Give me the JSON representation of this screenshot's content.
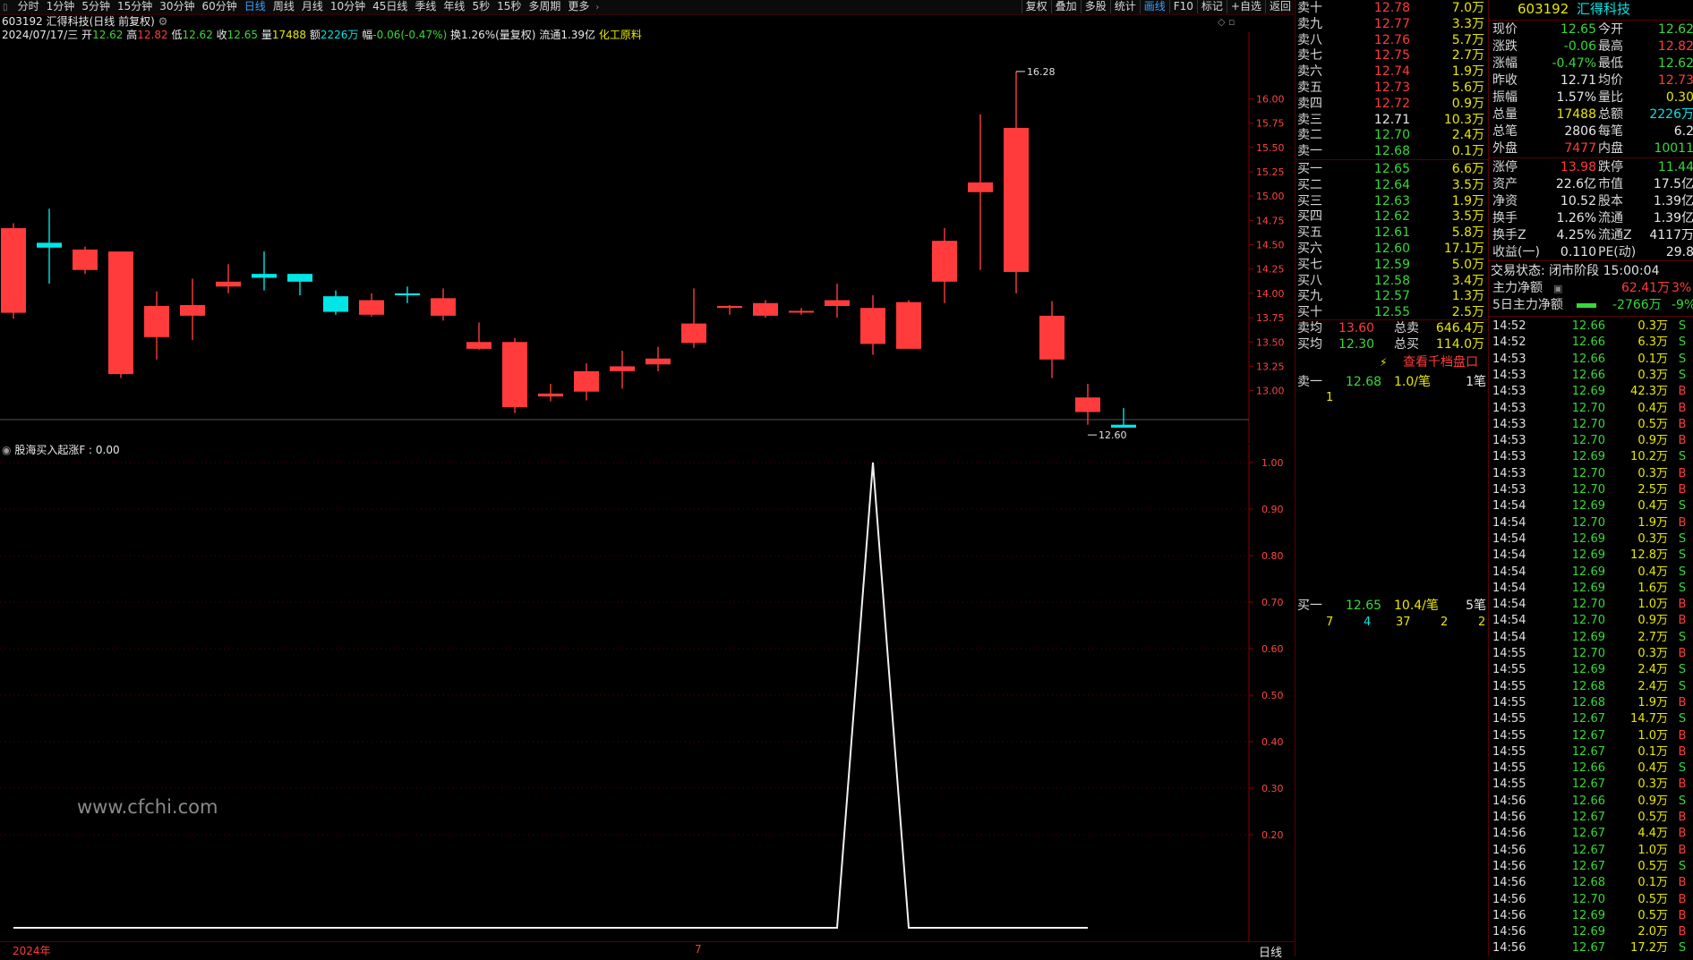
{
  "toolbar": {
    "left_items": [
      "分时",
      "1分钟",
      "5分钟",
      "15分钟",
      "30分钟",
      "60分钟",
      "日线",
      "周线",
      "月线",
      "10分钟",
      "45日线",
      "季线",
      "年线",
      "5秒",
      "15秒",
      "多周期",
      "更多"
    ],
    "active": "日线",
    "right_items": [
      "复权",
      "叠加",
      "多股",
      "统计",
      "画线",
      "F10",
      "标记",
      "+自选",
      "返回"
    ],
    "right_active": "画线"
  },
  "title_line": "603192 汇得科技(日线 前复权)",
  "ohlc": {
    "date": "2024/07/17/三",
    "open_label": "开",
    "open": "12.62",
    "high_label": "高",
    "high": "12.82",
    "low_label": "低",
    "low": "12.62",
    "close_label": "收",
    "close": "12.65",
    "vol_label": "量",
    "vol": "17488",
    "amt_label": "额",
    "amt": "2226万",
    "chg_label": "幅",
    "chg": "-0.06(-0.47%)",
    "turnover": "换1.26%(量复权)",
    "float": "流通1.39亿",
    "industry": "化工原料"
  },
  "kline": {
    "y_ticks": [
      "16.00",
      "15.75",
      "15.50",
      "15.25",
      "15.00",
      "14.75",
      "14.50",
      "14.25",
      "14.00",
      "13.75",
      "13.50",
      "13.25",
      "13.00"
    ],
    "ymin": 12.5,
    "ymax": 16.5,
    "max_label": "16.28",
    "min_label": "12.60",
    "candles": [
      {
        "o": 13.8,
        "c": 14.67,
        "h": 14.72,
        "l": 13.74
      },
      {
        "o": 14.52,
        "c": 14.47,
        "h": 14.87,
        "l": 14.1
      },
      {
        "o": 14.24,
        "c": 14.45,
        "h": 14.48,
        "l": 14.2
      },
      {
        "o": 13.17,
        "c": 14.43,
        "h": 14.1,
        "l": 13.13
      },
      {
        "o": 13.55,
        "c": 13.87,
        "h": 14.02,
        "l": 13.32
      },
      {
        "o": 13.77,
        "c": 13.88,
        "h": 14.15,
        "l": 13.52
      },
      {
        "o": 14.07,
        "c": 14.12,
        "h": 14.3,
        "l": 14.0
      },
      {
        "o": 14.2,
        "c": 14.16,
        "h": 14.43,
        "l": 14.03
      },
      {
        "o": 14.2,
        "c": 14.12,
        "h": 14.2,
        "l": 13.98
      },
      {
        "o": 13.97,
        "c": 13.81,
        "h": 14.03,
        "l": 13.78
      },
      {
        "o": 13.78,
        "c": 13.93,
        "h": 14.0,
        "l": 13.76
      },
      {
        "o": 14.0,
        "c": 13.98,
        "h": 14.07,
        "l": 13.9
      },
      {
        "o": 13.77,
        "c": 13.95,
        "h": 14.05,
        "l": 13.72
      },
      {
        "o": 13.43,
        "c": 13.5,
        "h": 13.7,
        "l": 13.42
      },
      {
        "o": 12.83,
        "c": 13.5,
        "h": 13.54,
        "l": 12.77
      },
      {
        "o": 12.94,
        "c": 12.97,
        "h": 13.07,
        "l": 12.89
      },
      {
        "o": 12.99,
        "c": 13.2,
        "h": 13.28,
        "l": 12.9
      },
      {
        "o": 13.2,
        "c": 13.25,
        "h": 13.41,
        "l": 13.02
      },
      {
        "o": 13.27,
        "c": 13.33,
        "h": 13.45,
        "l": 13.2
      },
      {
        "o": 13.49,
        "c": 13.69,
        "h": 14.05,
        "l": 13.44
      },
      {
        "o": 13.85,
        "c": 13.87,
        "h": 13.88,
        "l": 13.78
      },
      {
        "o": 13.77,
        "c": 13.9,
        "h": 13.93,
        "l": 13.75
      },
      {
        "o": 13.82,
        "c": 13.82,
        "h": 13.85,
        "l": 13.78
      },
      {
        "o": 13.87,
        "c": 13.93,
        "h": 14.1,
        "l": 13.75
      },
      {
        "o": 13.48,
        "c": 13.85,
        "h": 13.98,
        "l": 13.37
      },
      {
        "o": 13.43,
        "c": 13.91,
        "h": 13.93,
        "l": 13.43
      },
      {
        "o": 14.12,
        "c": 14.54,
        "h": 14.67,
        "l": 13.9
      },
      {
        "o": 15.04,
        "c": 15.14,
        "h": 15.84,
        "l": 14.24
      },
      {
        "o": 14.22,
        "c": 15.7,
        "h": 16.28,
        "l": 14.0
      },
      {
        "o": 13.32,
        "c": 13.77,
        "h": 13.92,
        "l": 13.13
      },
      {
        "o": 12.78,
        "c": 12.93,
        "h": 13.07,
        "l": 12.65
      },
      {
        "o": 12.65,
        "c": 12.62,
        "h": 12.82,
        "l": 12.62
      }
    ]
  },
  "indicator": {
    "name": "股海买入起涨F",
    "value": ": 0.00",
    "y_ticks": [
      "1.00",
      "0.90",
      "0.80",
      "0.70",
      "0.60",
      "0.50",
      "0.40",
      "0.30",
      "0.20"
    ],
    "values": [
      0,
      0,
      0,
      0,
      0,
      0,
      0,
      0,
      0,
      0,
      0,
      0,
      0,
      0,
      0,
      0,
      0,
      0,
      0,
      0,
      0,
      0,
      0,
      0,
      1,
      0,
      0,
      0,
      0,
      0,
      0
    ]
  },
  "watermark": "www.cfchi.com",
  "x_axis": {
    "left_label": "2024年",
    "mid_label": "7",
    "period": "日线"
  },
  "ask_book": [
    {
      "label": "卖十",
      "price": "12.78",
      "vol": "7.0万"
    },
    {
      "label": "卖九",
      "price": "12.77",
      "vol": "3.3万"
    },
    {
      "label": "卖八",
      "price": "12.76",
      "vol": "5.7万"
    },
    {
      "label": "卖七",
      "price": "12.75",
      "vol": "2.7万"
    },
    {
      "label": "卖六",
      "price": "12.74",
      "vol": "1.9万"
    },
    {
      "label": "卖五",
      "price": "12.73",
      "vol": "5.6万"
    },
    {
      "label": "卖四",
      "price": "12.72",
      "vol": "0.9万"
    },
    {
      "label": "卖三",
      "price": "12.71",
      "vol": "10.3万"
    },
    {
      "label": "卖二",
      "price": "12.70",
      "vol": "2.4万"
    },
    {
      "label": "卖一",
      "price": "12.68",
      "vol": "0.1万"
    }
  ],
  "bid_book": [
    {
      "label": "买一",
      "price": "12.65",
      "vol": "6.6万"
    },
    {
      "label": "买二",
      "price": "12.64",
      "vol": "3.5万"
    },
    {
      "label": "买三",
      "price": "12.63",
      "vol": "1.9万"
    },
    {
      "label": "买四",
      "price": "12.62",
      "vol": "3.5万"
    },
    {
      "label": "买五",
      "price": "12.61",
      "vol": "5.8万"
    },
    {
      "label": "买六",
      "price": "12.60",
      "vol": "17.1万"
    },
    {
      "label": "买七",
      "price": "12.59",
      "vol": "5.0万"
    },
    {
      "label": "买八",
      "price": "12.58",
      "vol": "3.4万"
    },
    {
      "label": "买九",
      "price": "12.57",
      "vol": "1.3万"
    },
    {
      "label": "买十",
      "price": "12.55",
      "vol": "2.5万"
    }
  ],
  "avg": {
    "sell_avg_label": "卖均",
    "sell_avg": "13.60",
    "total_sell_label": "总卖",
    "total_sell": "646.4万",
    "buy_avg_label": "买均",
    "buy_avg": "12.30",
    "total_buy_label": "总买",
    "total_buy": "114.0万"
  },
  "view_level": "查看千档盘口",
  "sell1_detail": {
    "label": "卖一",
    "price": "12.68",
    "per": "1.0/笔",
    "count": "1笔",
    "orders": [
      "1"
    ]
  },
  "buy1_detail": {
    "label": "买一",
    "price": "12.65",
    "per": "10.4/笔",
    "count": "5笔",
    "orders": [
      "7",
      "4",
      "37",
      "2",
      "2"
    ]
  },
  "quote": {
    "code": "603192",
    "name": "汇得科技",
    "rows": [
      {
        "l1": "现价",
        "v1": "12.65",
        "c1": "#38d838",
        "l2": "今开",
        "v2": "12.62",
        "c2": "#38d838"
      },
      {
        "l1": "涨跌",
        "v1": "-0.06",
        "c1": "#38d838",
        "l2": "最高",
        "v2": "12.82",
        "c2": "#ff3b3b"
      },
      {
        "l1": "涨幅",
        "v1": "-0.47%",
        "c1": "#38d838",
        "l2": "最低",
        "v2": "12.62",
        "c2": "#38d838"
      },
      {
        "l1": "昨收",
        "v1": "12.71",
        "c1": "#e8e8e8",
        "l2": "均价",
        "v2": "12.73",
        "c2": "#ff3b3b"
      },
      {
        "l1": "振幅",
        "v1": "1.57%",
        "c1": "#e8e8e8",
        "l2": "量比",
        "v2": "0.30",
        "c2": "#e8e800"
      },
      {
        "l1": "总量",
        "v1": "17488",
        "c1": "#e8e800",
        "l2": "总额",
        "v2": "2226万",
        "c2": "#00e6e6"
      },
      {
        "l1": "总笔",
        "v1": "2806",
        "c1": "#e8e8e8",
        "l2": "每笔",
        "v2": "6.2",
        "c2": "#e8e8e8"
      },
      {
        "l1": "外盘",
        "v1": "7477",
        "c1": "#ff3b3b",
        "l2": "内盘",
        "v2": "10011",
        "c2": "#38d838"
      }
    ],
    "rows2": [
      {
        "l1": "涨停",
        "v1": "13.98",
        "c1": "#ff3b3b",
        "l2": "跌停",
        "v2": "11.44",
        "c2": "#38d838"
      },
      {
        "l1": "资产",
        "v1": "22.6亿",
        "c1": "#e8e8e8",
        "l2": "市值",
        "v2": "17.5亿",
        "c2": "#e8e8e8"
      },
      {
        "l1": "净资",
        "v1": "10.52",
        "c1": "#e8e8e8",
        "l2": "股本",
        "v2": "1.39亿",
        "c2": "#e8e8e8"
      },
      {
        "l1": "换手",
        "v1": "1.26%",
        "c1": "#e8e8e8",
        "l2": "流通",
        "v2": "1.39亿",
        "c2": "#e8e8e8"
      },
      {
        "l1": "换手Z",
        "v1": "4.25%",
        "c1": "#e8e8e8",
        "l2": "流通Z",
        "v2": "4117万",
        "c2": "#e8e8e8"
      },
      {
        "l1": "收益(一)",
        "v1": "0.110",
        "c1": "#e8e8e8",
        "l2": "PE(动)",
        "v2": "29.8",
        "c2": "#e8e8e8"
      }
    ],
    "status": "交易状态: 闭市阶段 15:00:04",
    "main_net_label": "主力净额",
    "main_net": "62.41万",
    "main_net_pct": "3%",
    "main5_label": "5日主力净额",
    "main5": "-2766万",
    "main5_pct": "-9%"
  },
  "ticks": [
    {
      "t": "14:52",
      "p": "12.66",
      "v": "0.3万",
      "s": "S"
    },
    {
      "t": "14:52",
      "p": "12.66",
      "v": "6.3万",
      "s": "S"
    },
    {
      "t": "14:53",
      "p": "12.66",
      "v": "0.1万",
      "s": "S"
    },
    {
      "t": "14:53",
      "p": "12.66",
      "v": "0.3万",
      "s": "S"
    },
    {
      "t": "14:53",
      "p": "12.69",
      "v": "42.3万",
      "s": "B"
    },
    {
      "t": "14:53",
      "p": "12.70",
      "v": "0.4万",
      "s": "B"
    },
    {
      "t": "14:53",
      "p": "12.70",
      "v": "0.5万",
      "s": "B"
    },
    {
      "t": "14:53",
      "p": "12.70",
      "v": "0.9万",
      "s": "B"
    },
    {
      "t": "14:53",
      "p": "12.69",
      "v": "10.2万",
      "s": "S"
    },
    {
      "t": "14:53",
      "p": "12.70",
      "v": "0.3万",
      "s": "B"
    },
    {
      "t": "14:53",
      "p": "12.70",
      "v": "2.5万",
      "s": "B"
    },
    {
      "t": "14:54",
      "p": "12.69",
      "v": "0.4万",
      "s": "S"
    },
    {
      "t": "14:54",
      "p": "12.70",
      "v": "1.9万",
      "s": "B"
    },
    {
      "t": "14:54",
      "p": "12.69",
      "v": "0.3万",
      "s": "S"
    },
    {
      "t": "14:54",
      "p": "12.69",
      "v": "12.8万",
      "s": "S"
    },
    {
      "t": "14:54",
      "p": "12.69",
      "v": "0.4万",
      "s": "S"
    },
    {
      "t": "14:54",
      "p": "12.69",
      "v": "1.6万",
      "s": "S"
    },
    {
      "t": "14:54",
      "p": "12.70",
      "v": "1.0万",
      "s": "B"
    },
    {
      "t": "14:54",
      "p": "12.70",
      "v": "0.9万",
      "s": "B"
    },
    {
      "t": "14:54",
      "p": "12.69",
      "v": "2.7万",
      "s": "S"
    },
    {
      "t": "14:55",
      "p": "12.70",
      "v": "0.3万",
      "s": "B"
    },
    {
      "t": "14:55",
      "p": "12.69",
      "v": "2.4万",
      "s": "S"
    },
    {
      "t": "14:55",
      "p": "12.68",
      "v": "2.4万",
      "s": "S"
    },
    {
      "t": "14:55",
      "p": "12.68",
      "v": "1.9万",
      "s": "B"
    },
    {
      "t": "14:55",
      "p": "12.67",
      "v": "14.7万",
      "s": "S"
    },
    {
      "t": "14:55",
      "p": "12.67",
      "v": "1.0万",
      "s": "B"
    },
    {
      "t": "14:55",
      "p": "12.67",
      "v": "0.1万",
      "s": "B"
    },
    {
      "t": "14:55",
      "p": "12.66",
      "v": "0.4万",
      "s": "S"
    },
    {
      "t": "14:55",
      "p": "12.67",
      "v": "0.3万",
      "s": "B"
    },
    {
      "t": "14:56",
      "p": "12.66",
      "v": "0.9万",
      "s": "S"
    },
    {
      "t": "14:56",
      "p": "12.67",
      "v": "0.5万",
      "s": "B"
    },
    {
      "t": "14:56",
      "p": "12.67",
      "v": "4.4万",
      "s": "B"
    },
    {
      "t": "14:56",
      "p": "12.67",
      "v": "1.0万",
      "s": "B"
    },
    {
      "t": "14:56",
      "p": "12.67",
      "v": "0.5万",
      "s": "S"
    },
    {
      "t": "14:56",
      "p": "12.68",
      "v": "0.1万",
      "s": "B"
    },
    {
      "t": "14:56",
      "p": "12.70",
      "v": "0.5万",
      "s": "B"
    },
    {
      "t": "14:56",
      "p": "12.69",
      "v": "0.5万",
      "s": "B"
    },
    {
      "t": "14:56",
      "p": "12.69",
      "v": "2.0万",
      "s": "B"
    },
    {
      "t": "14:56",
      "p": "12.67",
      "v": "17.2万",
      "s": "S"
    }
  ]
}
